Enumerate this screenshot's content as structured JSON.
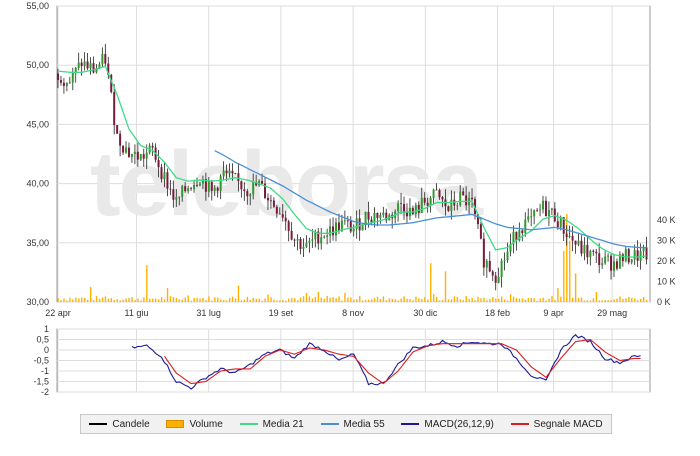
{
  "watermark": "teleborsa",
  "chart_data": [
    {
      "type": "candlestick",
      "panel": "price",
      "x_tick_labels": [
        "22 apr",
        "11 giu",
        "31 lug",
        "19 set",
        "8 nov",
        "30 dic",
        "18 feb",
        "9 apr",
        "29 mag"
      ],
      "y_tick_labels": [
        "55,00",
        "50,00",
        "45,00",
        "40,00",
        "35,00",
        "30,00"
      ],
      "ylim": [
        30,
        55
      ],
      "grid": true,
      "close_series_approx": {
        "x_index": [
          0,
          8,
          16,
          24,
          32,
          40,
          48,
          56,
          64,
          72,
          80,
          88,
          96,
          104,
          112,
          120,
          128,
          136,
          144,
          152,
          160,
          168,
          176,
          184,
          192,
          200,
          208,
          216,
          224,
          232,
          240,
          248,
          256,
          264,
          272,
          280,
          288,
          296,
          304,
          312,
          320,
          328,
          336,
          344,
          352,
          360,
          368,
          376,
          384,
          392,
          399
        ],
        "close": [
          49.3,
          48.6,
          50.2,
          49.6,
          50.5,
          44.0,
          42.6,
          42.2,
          42.8,
          40.5,
          38.4,
          39.8,
          40.6,
          39.2,
          40.8,
          40.2,
          39.5,
          39.9,
          38.5,
          37.5,
          35.3,
          34.6,
          35.6,
          36.0,
          36.6,
          36.2,
          37.2,
          37.4,
          37.2,
          38.3,
          37.4,
          38.5,
          39.0,
          37.8,
          38.8,
          38.2,
          33.6,
          32.3,
          34.2,
          36.4,
          36.8,
          38.0,
          37.3,
          35.8,
          34.6,
          34.0,
          33.4,
          33.3,
          33.8,
          33.9,
          34.0
        ]
      },
      "series": [
        {
          "name": "Media 21",
          "values_approx": [
            49.5,
            49.4,
            49.4,
            49.6,
            49.9,
            47.5,
            44.6,
            43.2,
            42.8,
            41.8,
            40.5,
            40.2,
            40.3,
            40.2,
            40.3,
            40.5,
            40.3,
            40.0,
            39.6,
            38.7,
            37.4,
            36.2,
            35.8,
            35.8,
            36.1,
            36.3,
            36.6,
            36.8,
            37.1,
            37.6,
            37.6,
            37.9,
            38.4,
            38.4,
            38.5,
            38.5,
            36.3,
            34.4,
            34.6,
            35.4,
            36.0,
            37.0,
            37.3,
            36.9,
            36.2,
            35.3,
            34.5,
            34.0,
            33.8,
            33.8,
            33.9
          ]
        },
        {
          "name": "Media 55",
          "values_approx": [
            null,
            null,
            null,
            null,
            null,
            null,
            null,
            null,
            null,
            null,
            null,
            null,
            null,
            42.9,
            42.4,
            41.8,
            41.3,
            40.8,
            40.3,
            39.8,
            39.2,
            38.6,
            38.1,
            37.6,
            37.2,
            36.8,
            36.6,
            36.5,
            36.5,
            36.6,
            36.7,
            36.9,
            37.1,
            37.2,
            37.3,
            37.4,
            37.0,
            36.6,
            36.3,
            36.2,
            36.1,
            36.2,
            36.3,
            36.1,
            35.8,
            35.5,
            35.2,
            34.9,
            34.7,
            34.6,
            34.6
          ]
        }
      ]
    },
    {
      "type": "bar",
      "panel": "volume",
      "series_name": "Volume",
      "y_tick_labels": [
        "40 K",
        "30 K",
        "20 K",
        "10 K",
        "0 K"
      ],
      "ylim": [
        0,
        45000
      ],
      "spikes_approx": [
        {
          "x_index": 60,
          "value": 18000
        },
        {
          "x_index": 122,
          "value": 8000
        },
        {
          "x_index": 252,
          "value": 19000
        },
        {
          "x_index": 262,
          "value": 15000
        },
        {
          "x_index": 342,
          "value": 25000
        },
        {
          "x_index": 344,
          "value": 43000
        },
        {
          "x_index": 347,
          "value": 30000
        },
        {
          "x_index": 350,
          "value": 14000
        }
      ],
      "baseline_value_approx": 1500
    },
    {
      "type": "line",
      "panel": "macd",
      "y_tick_labels": [
        "1",
        "0,5",
        "0",
        "-0,5",
        "-1",
        "-1,5",
        "-2"
      ],
      "ylim": [
        -2,
        1
      ],
      "series": [
        {
          "name": "MACD(26,12,9)",
          "values_approx": [
            0.1,
            0.2,
            -0.3,
            -1.5,
            -1.8,
            -1.3,
            -0.9,
            -1.1,
            -0.7,
            -0.2,
            0.0,
            -0.4,
            0.3,
            0.0,
            -0.5,
            -0.2,
            -1.6,
            -1.6,
            -0.7,
            0.1,
            0.2,
            0.4,
            0.2,
            0.4,
            0.3,
            0.3,
            -0.4,
            -1.2,
            -1.5,
            0.0,
            0.7,
            0.4,
            -0.4,
            -0.6,
            -0.3
          ]
        },
        {
          "name": "Segnale MACD",
          "values_approx": [
            null,
            null,
            -0.1,
            -1.1,
            -1.6,
            -1.5,
            -1.0,
            -0.9,
            -0.9,
            -0.3,
            0.0,
            -0.2,
            0.1,
            0.0,
            -0.2,
            -0.3,
            -1.1,
            -1.6,
            -1.0,
            -0.1,
            0.2,
            0.3,
            0.3,
            0.3,
            0.3,
            0.3,
            0.0,
            -0.8,
            -1.3,
            -0.4,
            0.4,
            0.5,
            -0.1,
            -0.5,
            -0.4
          ]
        }
      ]
    }
  ],
  "legend": [
    {
      "label": "Candele",
      "color": "#000000",
      "style": "line"
    },
    {
      "label": "Volume",
      "color": "#ffb000",
      "style": "bar"
    },
    {
      "label": "Media 21",
      "color": "#3ddc84",
      "style": "line"
    },
    {
      "label": "Media 55",
      "color": "#4a90d9",
      "style": "line"
    },
    {
      "label": "MACD(26,12,9)",
      "color": "#1a1a9a",
      "style": "line"
    },
    {
      "label": "Segnale MACD",
      "color": "#d92020",
      "style": "line"
    }
  ],
  "colors": {
    "candle_up": "#2e9a2e",
    "candle_down": "#7a1a3a",
    "volume": "#ffb000",
    "grid": "#dddddd",
    "axis": "#999999"
  }
}
